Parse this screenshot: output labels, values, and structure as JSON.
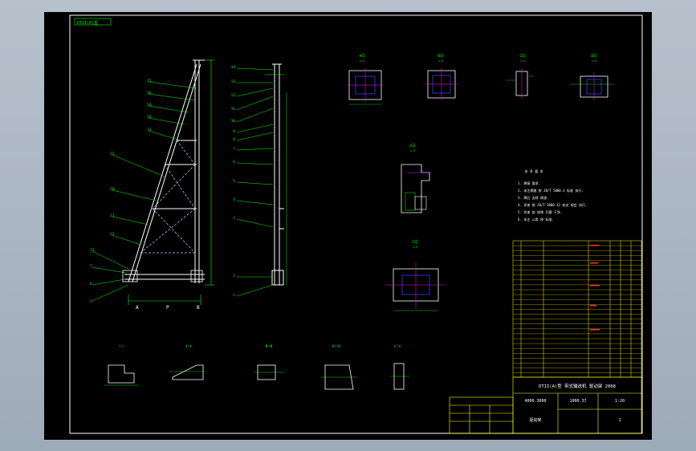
{
  "drawing": {
    "title_tag": "DTII(A)型",
    "main_views": {
      "left_labels": [
        "15",
        "16",
        "18",
        "14",
        "13",
        "12",
        "11",
        "10",
        "20",
        "21",
        "22",
        "23",
        "7",
        "8",
        "9",
        "1"
      ],
      "right_labels": [
        "14",
        "13",
        "12",
        "11",
        "10",
        "9",
        "8",
        "7",
        "6",
        "5",
        "4",
        "3",
        "2",
        "1"
      ],
      "dims": [
        "A",
        "P",
        "B"
      ]
    },
    "detail_views": [
      {
        "label": "A向",
        "scale": "1:5"
      },
      {
        "label": "B向",
        "scale": "1:5"
      },
      {
        "label": "C向",
        "scale": "1:5"
      },
      {
        "label": "D向",
        "scale": "1:5"
      },
      {
        "label": "E向",
        "scale": "1:5"
      },
      {
        "label": "F向",
        "scale": "1:5"
      }
    ],
    "section_views": [
      "Ⅰ-Ⅰ",
      "Ⅱ-Ⅱ",
      "Ⅲ-Ⅲ",
      "Ⅳ-Ⅳ",
      "Ⅴ-Ⅴ"
    ],
    "notes_title": "技 术 要 求",
    "notes": [
      "1. 焊接 要求.",
      "2. 未注焊缝 按 JB/T 5000.3 标准 执行.",
      "3. 焊后 去除 焊渣.",
      "4. 涂漆 按 JB/T 5000.12 有关 规定 执行.",
      "5. 涂漆 前 除锈 打磨 干净.",
      "6. 未注 公差 按 标准."
    ],
    "title_block": {
      "title": "DTII(A)型 带式输送机 驱动架 2008",
      "drawing_no": "4000.3000",
      "weight": "1000.37",
      "scale": "1:20",
      "sheet": "1",
      "part_name": "驱动架"
    }
  },
  "colors": {
    "background": "#000000",
    "frame": "#ffffff",
    "geometry": "#ffffff",
    "dimension": "#00ff00",
    "leader": "#00ff00",
    "table": "#ffff00",
    "accent": "#ff00ff",
    "blue": "#3a3aff"
  }
}
